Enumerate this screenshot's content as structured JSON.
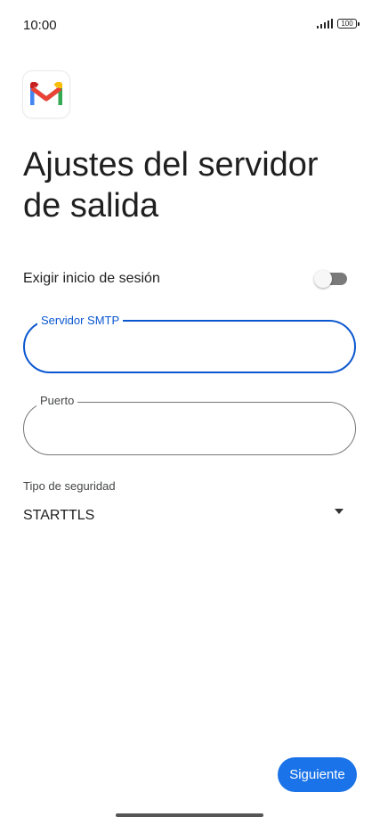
{
  "status_bar": {
    "time": "10:00",
    "battery": "100",
    "signal_icon": "signal-icon",
    "battery_icon": "battery-icon"
  },
  "app": {
    "logo_icon": "gmail-logo-icon",
    "title": "Ajustes del servidor de salida"
  },
  "login_toggle": {
    "label": "Exigir inicio de sesión",
    "enabled": false
  },
  "smtp_field": {
    "label": "Servidor SMTP",
    "value": "",
    "focused": true
  },
  "port_field": {
    "label": "Puerto",
    "value": ""
  },
  "security": {
    "label": "Tipo de seguridad",
    "selected": "STARTTLS"
  },
  "actions": {
    "next_label": "Siguiente"
  },
  "colors": {
    "accent": "#0b57d0",
    "button": "#1a73e8",
    "toggle_track": "#7a7a7a"
  }
}
